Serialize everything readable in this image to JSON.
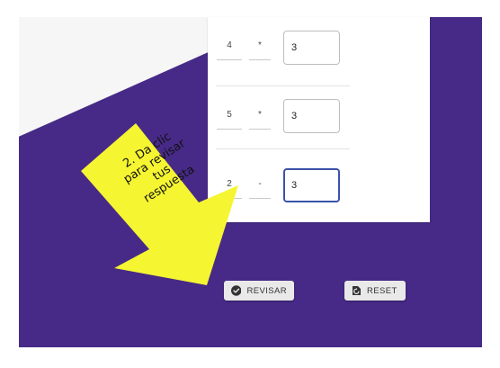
{
  "exercise": {
    "rows": [
      {
        "number": "4",
        "operator": "*",
        "answer": "3"
      },
      {
        "number": "5",
        "operator": "*",
        "answer": "3"
      },
      {
        "number": "2",
        "operator": "-",
        "answer": "3"
      }
    ]
  },
  "buttons": {
    "check_label": "REVISAR",
    "reset_label": "RESET"
  },
  "callout": {
    "lines": [
      "2. Da clic",
      "para revisar",
      "tus",
      "respuesta"
    ]
  },
  "colors": {
    "background": "#472a87",
    "callout": "#f5f531",
    "focus": "#3b52a8"
  },
  "icons": {
    "check": "check-circle-icon",
    "reset": "reset-icon"
  }
}
